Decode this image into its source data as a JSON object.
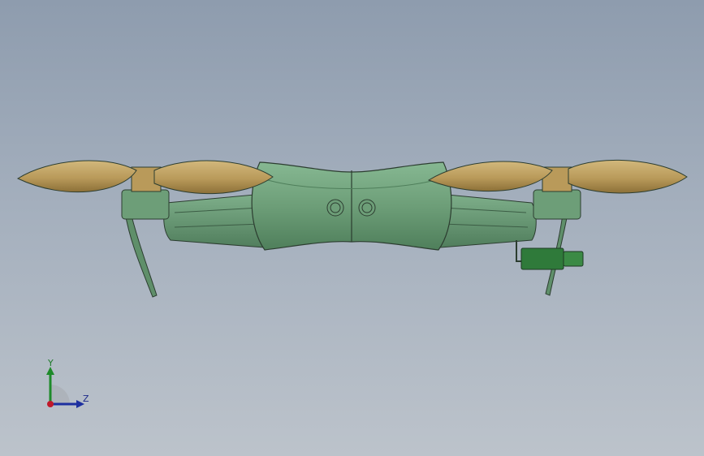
{
  "viewport": {
    "background_top": "#8e9cae",
    "background_bottom": "#bcc3cb"
  },
  "model": {
    "body_color": "#6d9e78",
    "body_dark": "#4f7f5b",
    "propeller_color": "#b99a5a",
    "propeller_dark": "#8c7038",
    "gimbal_color": "#2f7a3a"
  },
  "triad": {
    "axis_y_label": "Y",
    "axis_z_label": "Z",
    "y_color": "#1e8a2a",
    "z_color": "#1d2fa0",
    "x_color": "#c0182a"
  }
}
